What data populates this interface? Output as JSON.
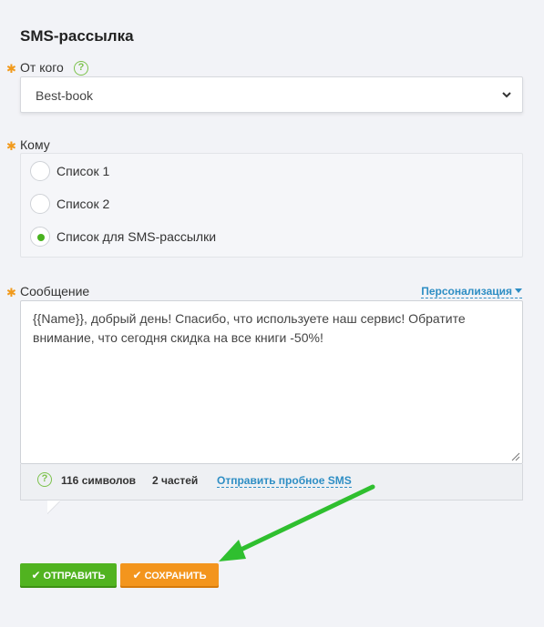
{
  "form": {
    "title": "SMS-рассылка",
    "required_mark": "✱",
    "from": {
      "label": "От кого",
      "help_icon": "?",
      "selected": "Best-book"
    },
    "to": {
      "label": "Кому",
      "options": [
        {
          "label": "Список 1",
          "checked": false
        },
        {
          "label": "Список 2",
          "checked": false
        },
        {
          "label": "Список для SMS-рассылки",
          "checked": true
        }
      ]
    },
    "message": {
      "label": "Сообщение",
      "personalization_label": "Персонализация",
      "text": "{{Name}}, добрый день! Спасибо, что используете наш сервис! Обратите внимание, что сегодня скидка на все книги -50%!",
      "help_icon": "?",
      "chars": "116 символов",
      "parts": "2 частей",
      "test_link": "Отправить пробное SMS"
    },
    "buttons": {
      "send_label": "ОТПРАВИТЬ",
      "save_label": "СОХРАНИТЬ",
      "check": "✔"
    }
  },
  "colors": {
    "accent_green": "#51b320",
    "accent_orange": "#f3951d",
    "link_blue": "#2e8ec4",
    "required_orange": "#f19a1c",
    "arrow_green": "#2fbf2f"
  }
}
